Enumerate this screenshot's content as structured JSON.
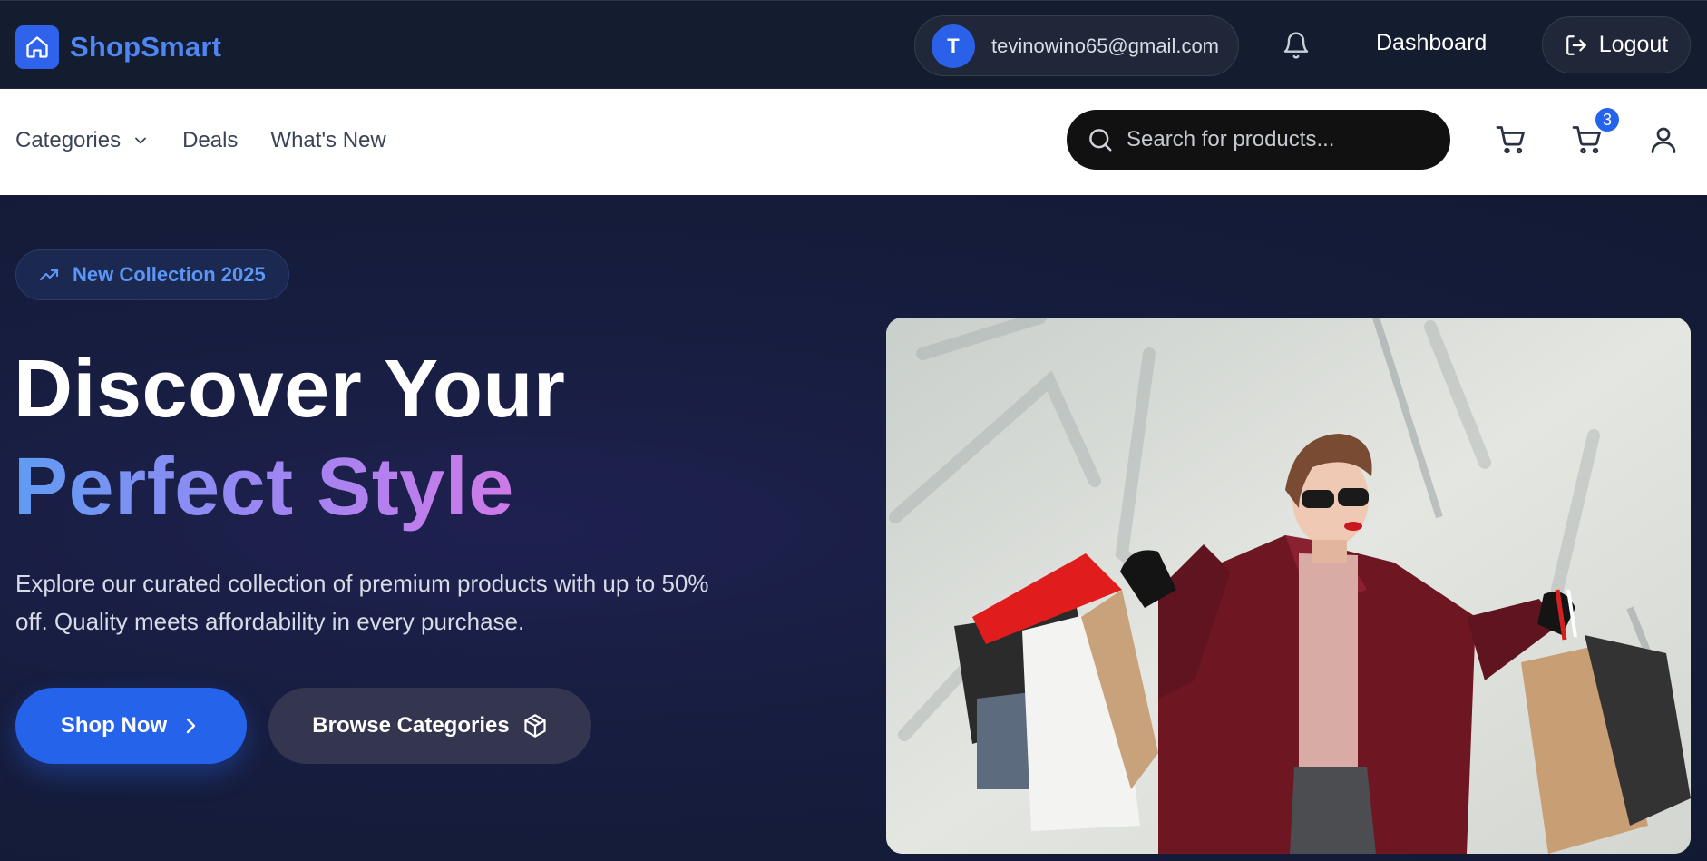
{
  "header": {
    "brand": "ShopSmart",
    "user": {
      "initial": "T",
      "email": "tevinowino65@gmail.com"
    },
    "dashboard_label": "Dashboard",
    "logout_label": "Logout"
  },
  "nav": {
    "links": [
      {
        "label": "Categories",
        "has_dropdown": true
      },
      {
        "label": "Deals"
      },
      {
        "label": "What's New"
      }
    ],
    "search_placeholder": "Search for products...",
    "cart_count": "3"
  },
  "hero": {
    "badge": "New Collection 2025",
    "title_line1": "Discover Your",
    "title_line2": "Perfect Style",
    "description": "Explore our curated collection of premium products with up to 50% off. Quality meets affordability in every purchase.",
    "primary_cta": "Shop Now",
    "secondary_cta": "Browse Categories"
  },
  "colors": {
    "brand": "#2f63eb",
    "brand_text": "#4f86f3",
    "primary": "#2563eb",
    "header_bg": "#141c30"
  },
  "icons": [
    "home-icon",
    "bell-icon",
    "logout-icon",
    "chevron-down-icon",
    "search-icon",
    "cart-icon",
    "user-icon",
    "trending-up-icon",
    "chevron-right-icon",
    "box-icon"
  ]
}
